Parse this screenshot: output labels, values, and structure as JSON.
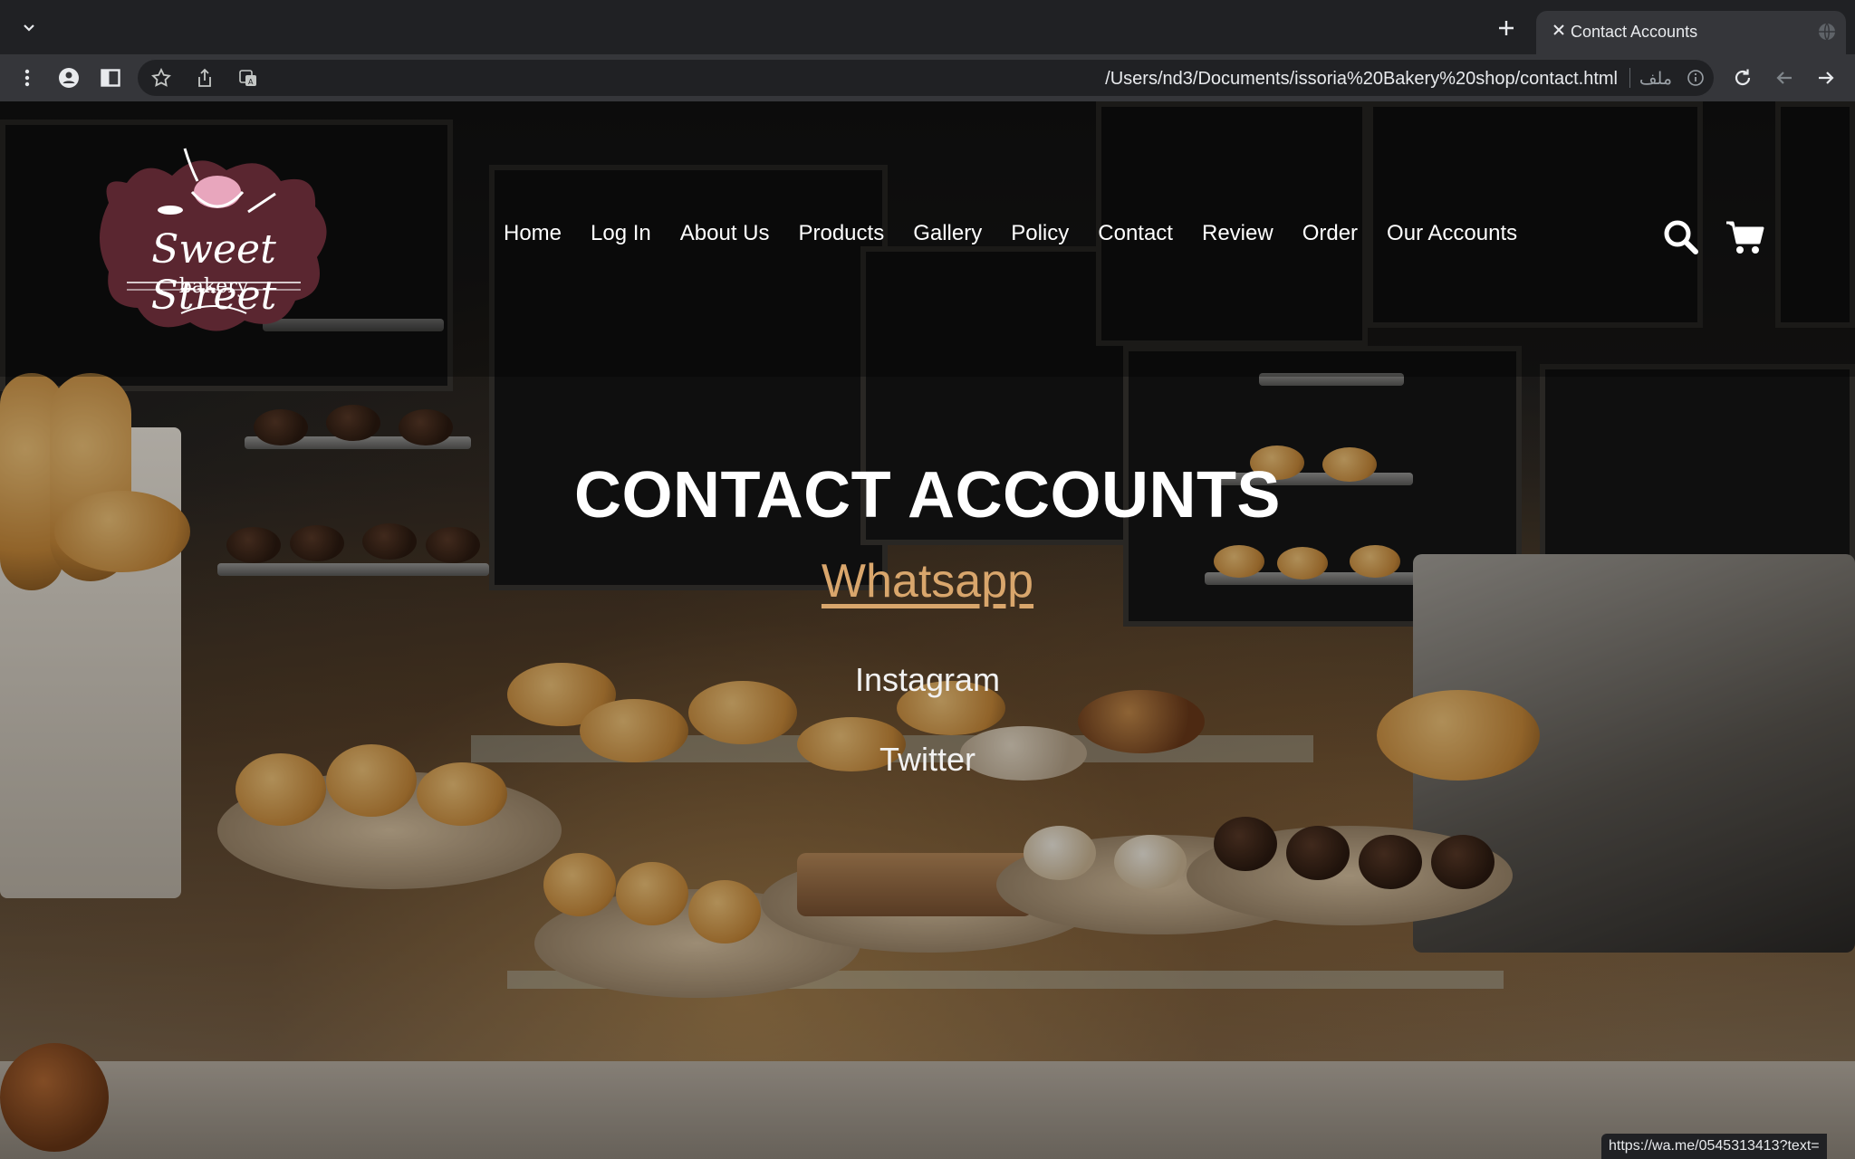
{
  "browser": {
    "tab_title": "Contact Accounts",
    "url": "/Users/nd3/Documents/issoria%20Bakery%20shop/contact.html",
    "url_scheme_label": "ملف",
    "status_url": "https://wa.me/0545313413?text="
  },
  "site": {
    "logo_line1": "Sweet Street",
    "logo_line2": "bakery",
    "nav": [
      "Home",
      "Log In",
      "About Us",
      "Products",
      "Gallery",
      "Policy",
      "Contact",
      "Review",
      "Order",
      "Our Accounts"
    ]
  },
  "main": {
    "title": "CONTACT ACCOUNTS",
    "links": [
      "Whatsapp",
      "Instagram",
      "Twitter"
    ]
  },
  "colors": {
    "chrome_dark": "#202124",
    "chrome_toolbar": "#35363a",
    "link_accent": "#d9a66c",
    "logo_maroon": "#5a2630",
    "logo_pink": "#e8a6bd"
  }
}
